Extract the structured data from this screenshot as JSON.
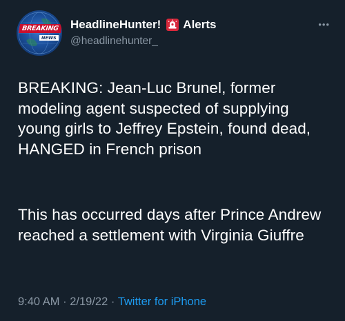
{
  "author": {
    "display_name": "HeadlineHunter!",
    "alerts_label": "Alerts",
    "handle": "@headlinehunter_",
    "avatar_text": "BREAKING",
    "avatar_subtext": "NEWS"
  },
  "tweet": {
    "paragraph1": "BREAKING: Jean-Luc Brunel, former modeling agent suspected of supplying young girls to Jeffrey Epstein, found dead, HANGED in French prison",
    "paragraph2": "This has occurred days after Prince Andrew reached a settlement with Virginia Giuffre"
  },
  "meta": {
    "time": "9:40 AM",
    "separator": "·",
    "date": "2/19/22",
    "source": "Twitter for iPhone"
  },
  "icons": {
    "more": "more-options-icon",
    "siren": "siren-icon"
  },
  "colors": {
    "background": "#15202b",
    "text": "#ffffff",
    "secondary_text": "#8b98a5",
    "link": "#1d9bf0"
  }
}
